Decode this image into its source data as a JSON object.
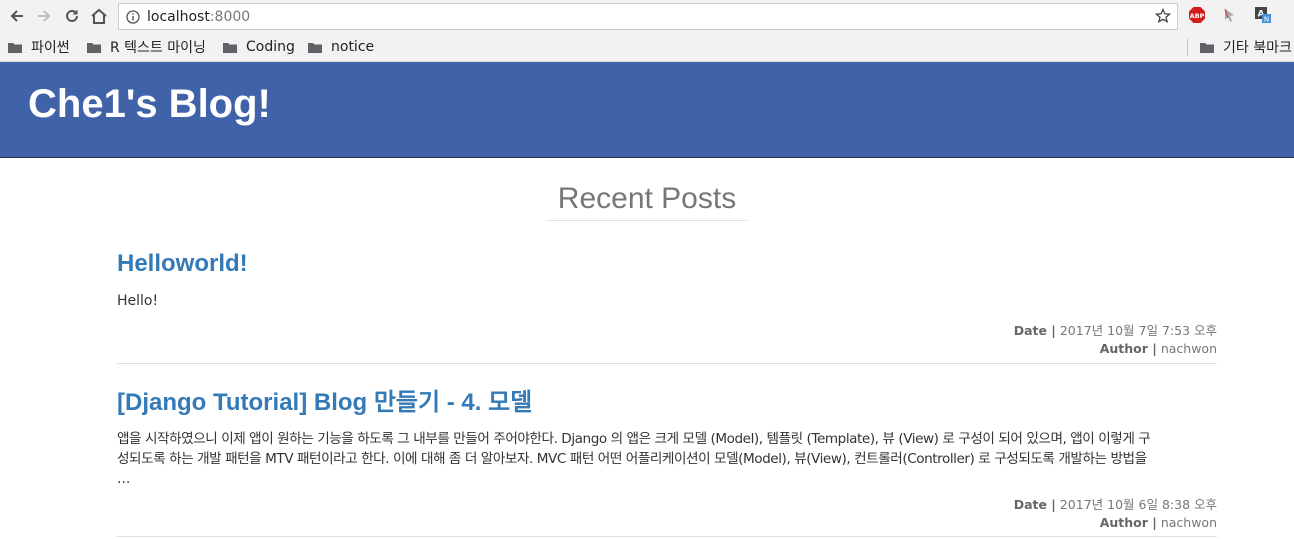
{
  "browser": {
    "url_host": "localhost",
    "url_port": ":8000"
  },
  "bookmarks": [
    "파이썬",
    "R 텍스트 마이닝",
    "Coding",
    "notice"
  ],
  "other_bookmarks": "기타 북마크",
  "extensions": {
    "abp": "ABP"
  },
  "blog": {
    "title": "Che1's Blog!",
    "section_title": "Recent Posts"
  },
  "posts": [
    {
      "title": "Helloworld!",
      "body": "Hello!",
      "date_label": "Date |",
      "date": "2017년 10월 7일 7:53 오후",
      "author_label": "Author |",
      "author": "nachwon"
    },
    {
      "title": "[Django Tutorial] Blog 만들기 - 4. 모델",
      "body_line1": "앱을 시작하였으니 이제 앱이 원하는 기능을 하도록 그 내부를 만들어 주어야한다. Django 의 앱은 크게 모델 (Model), 템플릿 (Template), 뷰 (View) 로 구성이 되어 있으며, 앱이 이렇게 구",
      "body_line2": "성되도록 하는 개발 패턴을 MTV 패턴이라고 한다. 이에 대해 좀 더 알아보자. MVC 패턴 어떤 어플리케이션이 모델(Model), 뷰(View), 컨트롤러(Controller) 로 구성되도록 개발하는 방법을",
      "body_line3": "...",
      "date_label": "Date |",
      "date": "2017년 10월 6일 8:38 오후",
      "author_label": "Author |",
      "author": "nachwon"
    }
  ]
}
